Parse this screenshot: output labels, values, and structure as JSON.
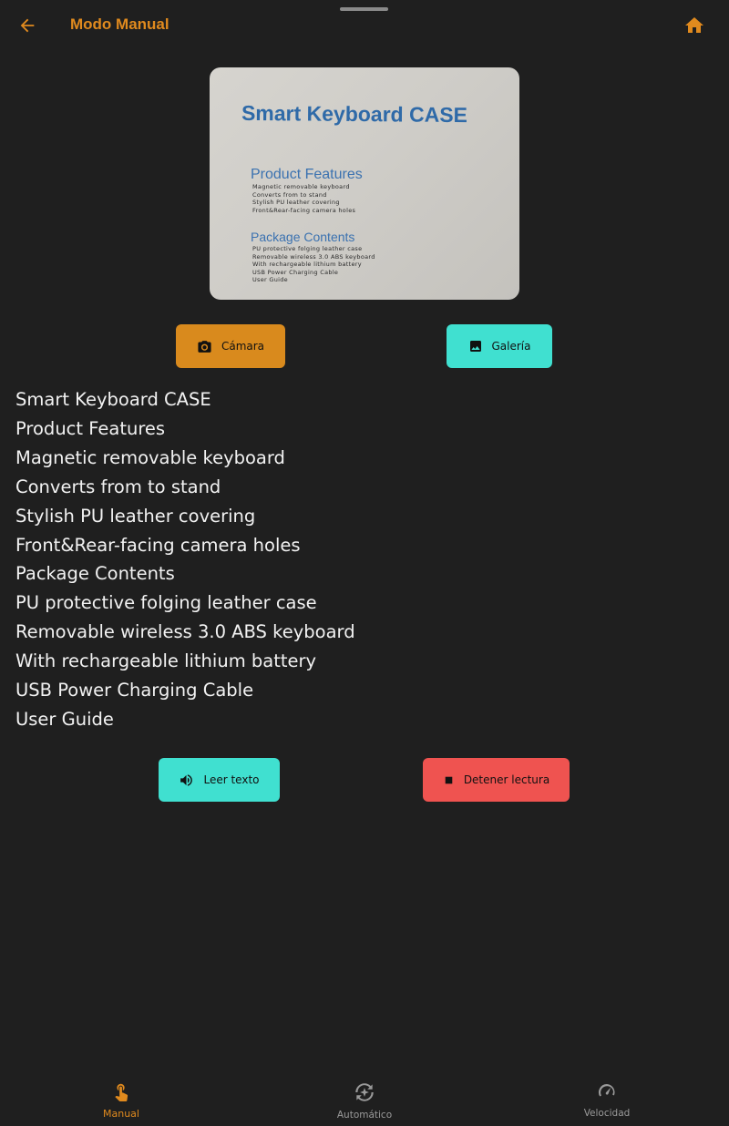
{
  "appbar": {
    "title": "Modo Manual",
    "back_icon": "arrow-back-icon",
    "home_icon": "home-icon",
    "accent_color": "#e08a1e"
  },
  "photo": {
    "title": "Smart Keyboard CASE",
    "features_heading": "Product Features",
    "features_lines": [
      "Magnetic removable keyboard",
      "Converts from to stand",
      "Stylish PU leather covering",
      "Front&Rear-facing camera holes"
    ],
    "package_heading": "Package Contents",
    "package_lines": [
      "PU protective folging leather case",
      "Removable wireless 3.0 ABS keyboard",
      "With rechargeable lithium battery",
      "USB Power Charging Cable",
      "User Guide"
    ]
  },
  "buttons": {
    "camera": {
      "label": "Cámara",
      "icon": "camera-icon",
      "color": "#d98a1d"
    },
    "gallery": {
      "label": "Galería",
      "icon": "image-icon",
      "color": "#40e0d0"
    },
    "read": {
      "label": "Leer texto",
      "icon": "volume-icon",
      "color": "#40e0d0"
    },
    "stop": {
      "label": "Detener lectura",
      "icon": "stop-icon",
      "color": "#ef5350"
    }
  },
  "recognized_text": [
    "Smart Keyboard CASE",
    "Product Features",
    "Magnetic removable keyboard",
    "Converts from to stand",
    "Stylish PU leather covering",
    "Front&Rear-facing camera holes",
    "Package Contents",
    "PU protective folging leather case",
    "Removable wireless 3.0 ABS keyboard",
    "With rechargeable lithium battery",
    "USB Power Charging Cable",
    "User Guide"
  ],
  "bottom_nav": {
    "active": "Manual",
    "items": [
      {
        "label": "Manual",
        "icon": "touch-hand-icon"
      },
      {
        "label": "Automático",
        "icon": "auto-sparkle-icon"
      },
      {
        "label": "Velocidad",
        "icon": "speedometer-icon"
      }
    ]
  }
}
